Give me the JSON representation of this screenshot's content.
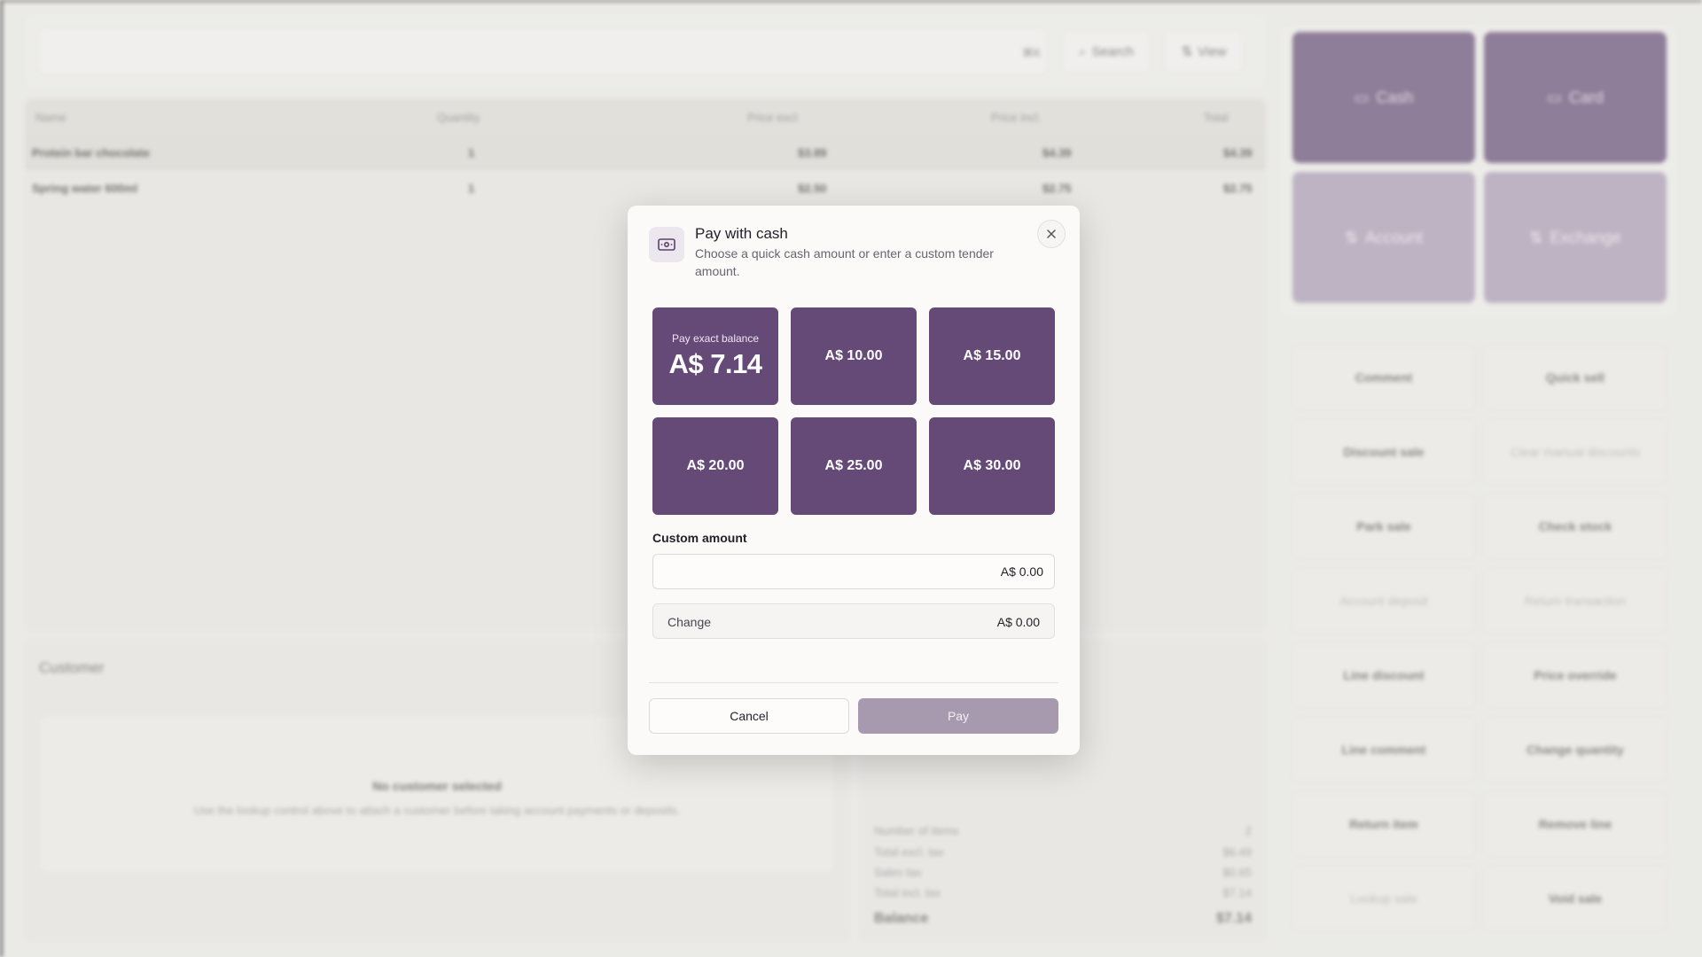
{
  "colors": {
    "accent": "#654a78",
    "accent_disabled": "#a89aae",
    "tender_dark": "#604570",
    "tender_light": "#a897b1"
  },
  "search": {
    "placeholder": "",
    "shortcut": "⌘K",
    "search_label": "Search",
    "view_label": "View"
  },
  "items_table": {
    "columns": [
      "Name",
      "Quantity",
      "Price excl.",
      "Price incl.",
      "Total"
    ],
    "rows": [
      {
        "name": "Protein bar chocolate",
        "quantity": "1",
        "price_excl": "$3.89",
        "price_incl": "$4.39",
        "total": "$4.39"
      },
      {
        "name": "Spring water 600ml",
        "quantity": "1",
        "price_excl": "$2.50",
        "price_incl": "$2.75",
        "total": "$2.75"
      }
    ]
  },
  "customer": {
    "heading": "Customer",
    "empty_title": "No customer selected",
    "empty_text": "Use the lookup control above to attach a customer before taking account payments or deposits."
  },
  "totals": {
    "number_of_items_label": "Number of items",
    "number_of_items": "2",
    "total_excl_label": "Total excl. tax",
    "total_excl": "$6.49",
    "sales_tax_label": "Sales tax",
    "sales_tax": "$0.65",
    "total_incl_label": "Total incl. tax",
    "total_incl": "$7.14",
    "balance_label": "Balance",
    "balance": "$7.14"
  },
  "tender_buttons": {
    "cash": "Cash",
    "card": "Card",
    "account": "Account",
    "exchange": "Exchange"
  },
  "actions": {
    "comment": "Comment",
    "quick_sell": "Quick sell",
    "discount_sale": "Discount sale",
    "clear_manual_discounts": "Clear manual discounts",
    "park_sale": "Park sale",
    "check_stock": "Check stock",
    "account_deposit": "Account deposit",
    "return_transaction": "Return transaction",
    "line_discount": "Line discount",
    "price_override": "Price override",
    "line_comment": "Line comment",
    "change_quantity": "Change quantity",
    "return_item": "Return item",
    "remove_line": "Remove line",
    "lookup_sale": "Lookup sale",
    "void_sale": "Void sale"
  },
  "dialog": {
    "title": "Pay with cash",
    "description": "Choose a quick cash amount or enter a custom tender amount.",
    "exact_label": "Pay exact balance",
    "exact_amount": "A$ 7.14",
    "quick_amounts": [
      "A$ 10.00",
      "A$ 15.00",
      "A$ 20.00",
      "A$ 25.00",
      "A$ 30.00"
    ],
    "custom_amount_label": "Custom amount",
    "custom_amount_placeholder": "A$ 0.00",
    "change_label": "Change",
    "change_value": "A$ 0.00",
    "cancel_label": "Cancel",
    "pay_label": "Pay"
  }
}
